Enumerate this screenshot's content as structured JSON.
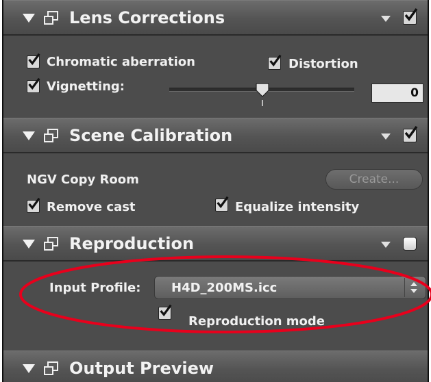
{
  "lens": {
    "title": "Lens Corrections",
    "chromatic": "Chromatic aberration",
    "distortion": "Distortion",
    "vignetting": "Vignetting:",
    "vignetting_value": "0"
  },
  "scene": {
    "title": "Scene Calibration",
    "name": "NGV Copy Room",
    "create_button": "Create...",
    "remove_cast": "Remove cast",
    "equalize": "Equalize intensity"
  },
  "repro": {
    "title": "Reproduction",
    "input_profile_label": "Input Profile:",
    "input_profile_value": "H4D_200MS.icc",
    "mode_label": "Reproduction mode"
  },
  "output": {
    "title": "Output Preview"
  },
  "icons": [
    "disclosure-triangle-icon",
    "window-icon",
    "menu-triangle-icon",
    "checkbox-checked-icon",
    "slider-knob-icon",
    "stepper-icon"
  ],
  "colors": {
    "panel_bg": "#4c4c4c",
    "header_bg": "#5c5c5c",
    "highlight_ellipse": "#e8001c",
    "text": "#f0f0f0"
  }
}
